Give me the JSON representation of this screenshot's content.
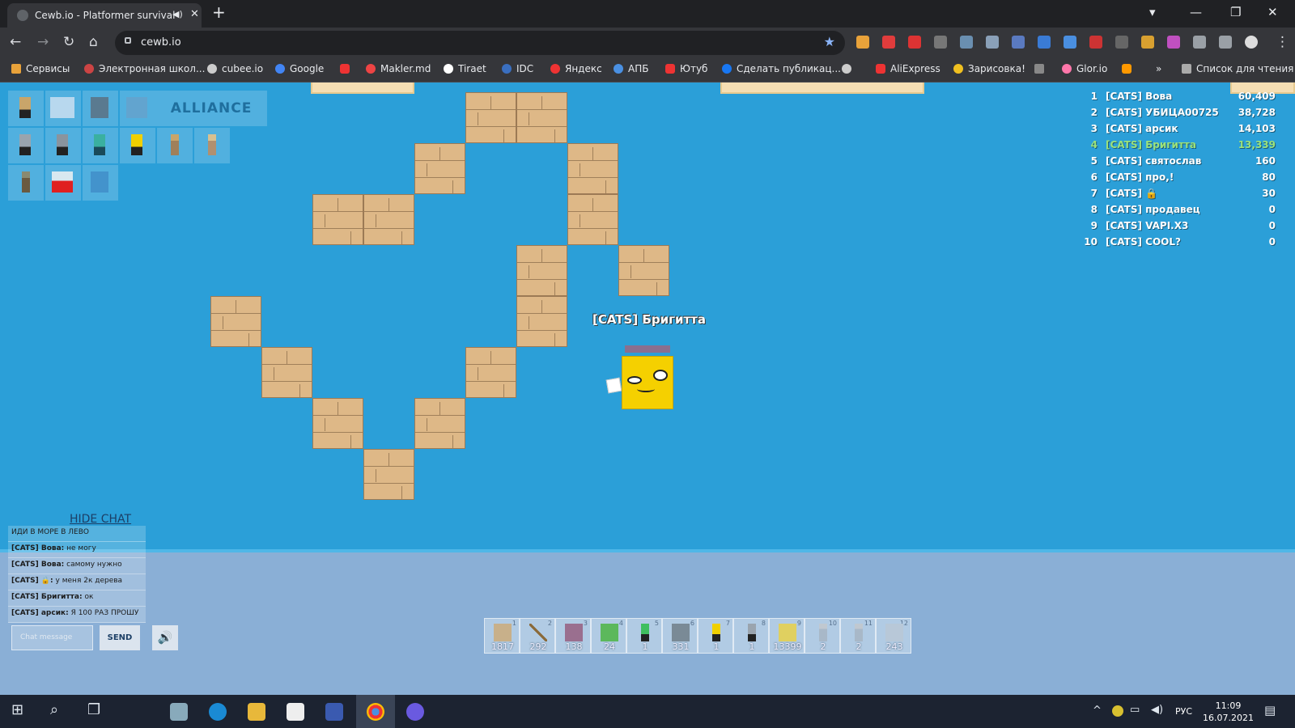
{
  "browser": {
    "tab_title": "Cewb.io - Platformer survival",
    "url": "cewb.io",
    "bookmarks": [
      "Сервисы",
      "Электронная школ...",
      "cubee.io",
      "Google",
      "Makler.md",
      "Tiraet",
      "IDC",
      "Яндекс",
      "АПБ",
      "Ютуб",
      "Сделать публикац...",
      "AliExpress",
      "Зарисовка!",
      "Glor.io",
      "»",
      "Список для чтения"
    ]
  },
  "hud": {
    "alliance_label": "ALLIANCE",
    "hide_chat_label": "HIDE CHAT",
    "chat_placeholder": "Chat message",
    "send_label": "SEND",
    "player_name": "[CATS] Бригитта"
  },
  "leaderboard": [
    {
      "rank": "1",
      "name": "[CATS] Вова",
      "score": "60,409"
    },
    {
      "rank": "2",
      "name": "[CATS] УБИЦА00725",
      "score": "38,728"
    },
    {
      "rank": "3",
      "name": "[CATS] арсик",
      "score": "14,103"
    },
    {
      "rank": "4",
      "name": "[CATS] Бригитта",
      "score": "13,339"
    },
    {
      "rank": "5",
      "name": "[CATS] святослав",
      "score": "160"
    },
    {
      "rank": "6",
      "name": "[CATS] про,!",
      "score": "80"
    },
    {
      "rank": "7",
      "name": "[CATS] 🔒",
      "score": "30"
    },
    {
      "rank": "8",
      "name": "[CATS] продавец",
      "score": "0"
    },
    {
      "rank": "9",
      "name": "[CATS] VAPI.X3",
      "score": "0"
    },
    {
      "rank": "10",
      "name": "[CATS] COOL?",
      "score": "0"
    }
  ],
  "chat": [
    {
      "who": "",
      "text": "ИДИ В МОРЕ В ЛЕВО"
    },
    {
      "who": "[CATS] Вова:",
      "text": "не могу"
    },
    {
      "who": "[CATS] Вова:",
      "text": "самому нужно"
    },
    {
      "who": "[CATS] 🔒:",
      "text": "у меня 2к дерева"
    },
    {
      "who": "[CATS] Бригитта:",
      "text": "ок"
    },
    {
      "who": "[CATS] арсик:",
      "text": "Я 100 РАЗ ПРОШУ"
    }
  ],
  "hotbar": [
    {
      "num": "1",
      "count": "1817",
      "color": "#c8b08a"
    },
    {
      "num": "2",
      "count": "292",
      "color": "#8a6a3a"
    },
    {
      "num": "3",
      "count": "138",
      "color": "#9a6f8f"
    },
    {
      "num": "4",
      "count": "24",
      "color": "#5cb85c"
    },
    {
      "num": "5",
      "count": "1",
      "color": "#3fbf5f"
    },
    {
      "num": "6",
      "count": "331",
      "color": "#7a8a96"
    },
    {
      "num": "7",
      "count": "1",
      "color": "#f0d000"
    },
    {
      "num": "8",
      "count": "1",
      "color": "#9aa4ae"
    },
    {
      "num": "9",
      "count": "13399",
      "color": "#e0d060"
    },
    {
      "num": "10",
      "count": "2",
      "color": "#a8b8c8"
    },
    {
      "num": "11",
      "count": "2",
      "color": "#a8b8c8"
    },
    {
      "num": "12",
      "count": "243",
      "color": "#b8c8d8"
    }
  ],
  "taskbar": {
    "lang": "РУС",
    "time": "11:09",
    "date": "16.07.2021"
  }
}
